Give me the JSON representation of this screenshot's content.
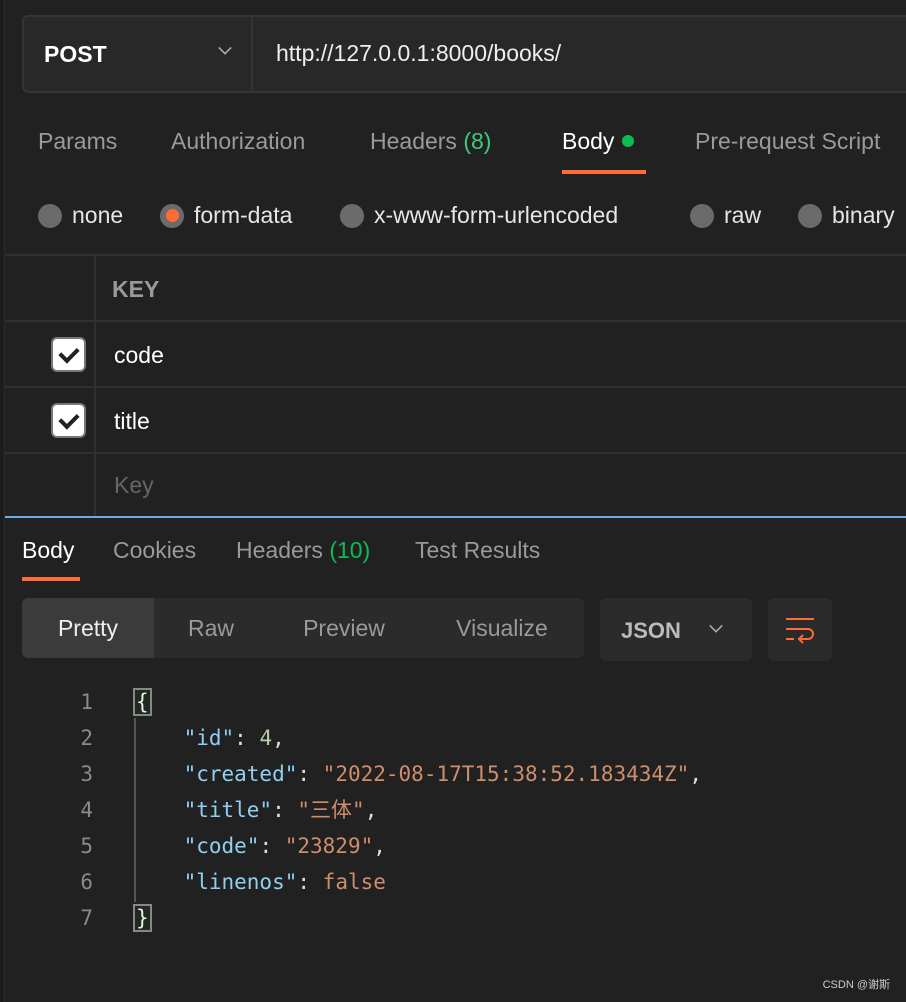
{
  "request": {
    "method": "POST",
    "url": "http://127.0.0.1:8000/books/"
  },
  "request_tabs": [
    {
      "label": "Params"
    },
    {
      "label": "Authorization"
    },
    {
      "label": "Headers",
      "count": "(8)"
    },
    {
      "label": "Body",
      "active": true
    },
    {
      "label": "Pre-request Script"
    }
  ],
  "body_types": [
    {
      "label": "none"
    },
    {
      "label": "form-data",
      "selected": true
    },
    {
      "label": "x-www-form-urlencoded"
    },
    {
      "label": "raw"
    },
    {
      "label": "binary"
    }
  ],
  "form_table": {
    "header": "KEY",
    "rows": [
      {
        "key": "code",
        "checked": true
      },
      {
        "key": "title",
        "checked": true
      }
    ],
    "placeholder": "Key"
  },
  "response_tabs": [
    {
      "label": "Body",
      "active": true
    },
    {
      "label": "Cookies"
    },
    {
      "label": "Headers",
      "count": "(10)"
    },
    {
      "label": "Test Results"
    }
  ],
  "view_modes": [
    "Pretty",
    "Raw",
    "Preview",
    "Visualize"
  ],
  "active_view": "Pretty",
  "format": "JSON",
  "wrap_icon": "wrap-lines-icon",
  "response_lines": {
    "l1": {
      "num": "1",
      "text": "{"
    },
    "l2": {
      "num": "2",
      "key": "\"id\"",
      "value": "4"
    },
    "l3": {
      "num": "3",
      "key": "\"created\"",
      "value": "\"2022-08-17T15:38:52.183434Z\""
    },
    "l4": {
      "num": "4",
      "key": "\"title\"",
      "value": "\"三体\""
    },
    "l5": {
      "num": "5",
      "key": "\"code\"",
      "value": "\"23829\""
    },
    "l6": {
      "num": "6",
      "key": "\"linenos\"",
      "value": "false"
    },
    "l7": {
      "num": "7",
      "text": "}"
    }
  },
  "colors": {
    "accent": "#ff6c37",
    "green": "#0cbb52",
    "divider_blue": "#6fa9e8"
  },
  "watermark": "CSDN @谢斯"
}
